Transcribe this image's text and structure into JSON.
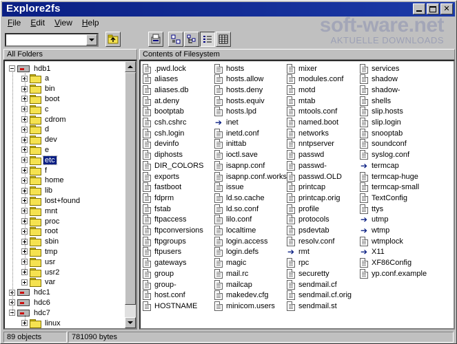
{
  "window": {
    "title": "Explore2fs"
  },
  "menu": [
    {
      "label": "File",
      "key": "F",
      "rest": "ile"
    },
    {
      "label": "Edit",
      "key": "E",
      "rest": "dit"
    },
    {
      "label": "View",
      "key": "V",
      "rest": "iew"
    },
    {
      "label": "Help",
      "key": "H",
      "rest": "elp"
    }
  ],
  "toolbar": {
    "path_value": ""
  },
  "watermark": {
    "logo": "soft-ware.net",
    "subtitle": "AKTUELLE DOWNLOADS"
  },
  "tree": {
    "header": "All Folders",
    "items": [
      {
        "label": "hdb1",
        "type": "drive",
        "level": 0,
        "expander": "minus"
      },
      {
        "label": "a",
        "type": "folder",
        "level": 1,
        "expander": "plus"
      },
      {
        "label": "bin",
        "type": "folder",
        "level": 1,
        "expander": "plus"
      },
      {
        "label": "boot",
        "type": "folder",
        "level": 1,
        "expander": "plus"
      },
      {
        "label": "c",
        "type": "folder",
        "level": 1,
        "expander": "plus"
      },
      {
        "label": "cdrom",
        "type": "folder",
        "level": 1,
        "expander": "plus"
      },
      {
        "label": "d",
        "type": "folder",
        "level": 1,
        "expander": "plus"
      },
      {
        "label": "dev",
        "type": "folder",
        "level": 1,
        "expander": "plus"
      },
      {
        "label": "e",
        "type": "folder",
        "level": 1,
        "expander": "plus"
      },
      {
        "label": "etc",
        "type": "folder",
        "level": 1,
        "expander": "plus",
        "selected": true
      },
      {
        "label": "f",
        "type": "folder",
        "level": 1,
        "expander": "plus"
      },
      {
        "label": "home",
        "type": "folder",
        "level": 1,
        "expander": "plus"
      },
      {
        "label": "lib",
        "type": "folder",
        "level": 1,
        "expander": "plus"
      },
      {
        "label": "lost+found",
        "type": "folder",
        "level": 1,
        "expander": "plus"
      },
      {
        "label": "mnt",
        "type": "folder",
        "level": 1,
        "expander": "plus"
      },
      {
        "label": "proc",
        "type": "folder",
        "level": 1,
        "expander": "plus"
      },
      {
        "label": "root",
        "type": "folder",
        "level": 1,
        "expander": "plus"
      },
      {
        "label": "sbin",
        "type": "folder",
        "level": 1,
        "expander": "plus"
      },
      {
        "label": "tmp",
        "type": "folder",
        "level": 1,
        "expander": "plus"
      },
      {
        "label": "usr",
        "type": "folder",
        "level": 1,
        "expander": "plus"
      },
      {
        "label": "usr2",
        "type": "folder",
        "level": 1,
        "expander": "plus"
      },
      {
        "label": "var",
        "type": "folder",
        "level": 1,
        "expander": "plus"
      },
      {
        "label": "hdc1",
        "type": "drive",
        "level": 0,
        "expander": "plus"
      },
      {
        "label": "hdc6",
        "type": "drive",
        "level": 0,
        "expander": "plus"
      },
      {
        "label": "hdc7",
        "type": "drive",
        "level": 0,
        "expander": "minus"
      },
      {
        "label": "linux",
        "type": "folder",
        "level": 1,
        "expander": "plus"
      }
    ]
  },
  "list": {
    "header": "Contents of Filesystem",
    "columns": [
      [
        {
          "name": ".pwd.lock",
          "icon": "file"
        },
        {
          "name": "aliases",
          "icon": "file"
        },
        {
          "name": "aliases.db",
          "icon": "file"
        },
        {
          "name": "at.deny",
          "icon": "file"
        },
        {
          "name": "bootptab",
          "icon": "file"
        },
        {
          "name": "csh.cshrc",
          "icon": "file"
        },
        {
          "name": "csh.login",
          "icon": "file"
        },
        {
          "name": "devinfo",
          "icon": "file"
        },
        {
          "name": "diphosts",
          "icon": "file"
        },
        {
          "name": "DIR_COLORS",
          "icon": "file"
        },
        {
          "name": "exports",
          "icon": "file"
        },
        {
          "name": "fastboot",
          "icon": "file"
        },
        {
          "name": "fdprm",
          "icon": "file"
        },
        {
          "name": "fstab",
          "icon": "file"
        },
        {
          "name": "ftpaccess",
          "icon": "file"
        },
        {
          "name": "ftpconversions",
          "icon": "file"
        },
        {
          "name": "ftpgroups",
          "icon": "file"
        },
        {
          "name": "ftpusers",
          "icon": "file"
        },
        {
          "name": "gateways",
          "icon": "file"
        },
        {
          "name": "group",
          "icon": "file"
        },
        {
          "name": "group-",
          "icon": "file"
        },
        {
          "name": "host.conf",
          "icon": "file"
        },
        {
          "name": "HOSTNAME",
          "icon": "file"
        }
      ],
      [
        {
          "name": "hosts",
          "icon": "file"
        },
        {
          "name": "hosts.allow",
          "icon": "file"
        },
        {
          "name": "hosts.deny",
          "icon": "file"
        },
        {
          "name": "hosts.equiv",
          "icon": "file"
        },
        {
          "name": "hosts.lpd",
          "icon": "file"
        },
        {
          "name": "inet",
          "icon": "link"
        },
        {
          "name": "inetd.conf",
          "icon": "file"
        },
        {
          "name": "inittab",
          "icon": "file"
        },
        {
          "name": "ioctl.save",
          "icon": "file"
        },
        {
          "name": "isapnp.conf",
          "icon": "file"
        },
        {
          "name": "isapnp.conf.works",
          "icon": "file"
        },
        {
          "name": "issue",
          "icon": "file"
        },
        {
          "name": "ld.so.cache",
          "icon": "file"
        },
        {
          "name": "ld.so.conf",
          "icon": "file"
        },
        {
          "name": "lilo.conf",
          "icon": "file"
        },
        {
          "name": "localtime",
          "icon": "file"
        },
        {
          "name": "login.access",
          "icon": "file"
        },
        {
          "name": "login.defs",
          "icon": "file"
        },
        {
          "name": "magic",
          "icon": "file"
        },
        {
          "name": "mail.rc",
          "icon": "file"
        },
        {
          "name": "mailcap",
          "icon": "file"
        },
        {
          "name": "makedev.cfg",
          "icon": "file"
        },
        {
          "name": "minicom.users",
          "icon": "file"
        }
      ],
      [
        {
          "name": "mixer",
          "icon": "file"
        },
        {
          "name": "modules.conf",
          "icon": "file"
        },
        {
          "name": "motd",
          "icon": "file"
        },
        {
          "name": "mtab",
          "icon": "file"
        },
        {
          "name": "mtools.conf",
          "icon": "file"
        },
        {
          "name": "named.boot",
          "icon": "file"
        },
        {
          "name": "networks",
          "icon": "file"
        },
        {
          "name": "nntpserver",
          "icon": "file"
        },
        {
          "name": "passwd",
          "icon": "file"
        },
        {
          "name": "passwd-",
          "icon": "file"
        },
        {
          "name": "passwd.OLD",
          "icon": "file"
        },
        {
          "name": "printcap",
          "icon": "file"
        },
        {
          "name": "printcap.orig",
          "icon": "file"
        },
        {
          "name": "profile",
          "icon": "file"
        },
        {
          "name": "protocols",
          "icon": "file"
        },
        {
          "name": "psdevtab",
          "icon": "file"
        },
        {
          "name": "resolv.conf",
          "icon": "file"
        },
        {
          "name": "rmt",
          "icon": "link"
        },
        {
          "name": "rpc",
          "icon": "file"
        },
        {
          "name": "securetty",
          "icon": "file"
        },
        {
          "name": "sendmail.cf",
          "icon": "file"
        },
        {
          "name": "sendmail.cf.orig",
          "icon": "file"
        },
        {
          "name": "sendmail.st",
          "icon": "file"
        }
      ],
      [
        {
          "name": "services",
          "icon": "file"
        },
        {
          "name": "shadow",
          "icon": "file"
        },
        {
          "name": "shadow-",
          "icon": "file"
        },
        {
          "name": "shells",
          "icon": "file"
        },
        {
          "name": "slip.hosts",
          "icon": "file"
        },
        {
          "name": "slip.login",
          "icon": "file"
        },
        {
          "name": "snooptab",
          "icon": "file"
        },
        {
          "name": "soundconf",
          "icon": "file"
        },
        {
          "name": "syslog.conf",
          "icon": "file"
        },
        {
          "name": "termcap",
          "icon": "link"
        },
        {
          "name": "termcap-huge",
          "icon": "file"
        },
        {
          "name": "termcap-small",
          "icon": "file"
        },
        {
          "name": "TextConfig",
          "icon": "file"
        },
        {
          "name": "ttys",
          "icon": "file"
        },
        {
          "name": "utmp",
          "icon": "link"
        },
        {
          "name": "wtmp",
          "icon": "link"
        },
        {
          "name": "wtmplock",
          "icon": "file"
        },
        {
          "name": "X11",
          "icon": "link"
        },
        {
          "name": "XF86Config",
          "icon": "file"
        },
        {
          "name": "yp.conf.example",
          "icon": "file"
        }
      ]
    ]
  },
  "status": {
    "objects": "89 objects",
    "size": "781090 bytes"
  },
  "colors": {
    "titlebar": "#0a1f83",
    "selection": "#0a1f83",
    "chrome": "#c0c0c0"
  }
}
